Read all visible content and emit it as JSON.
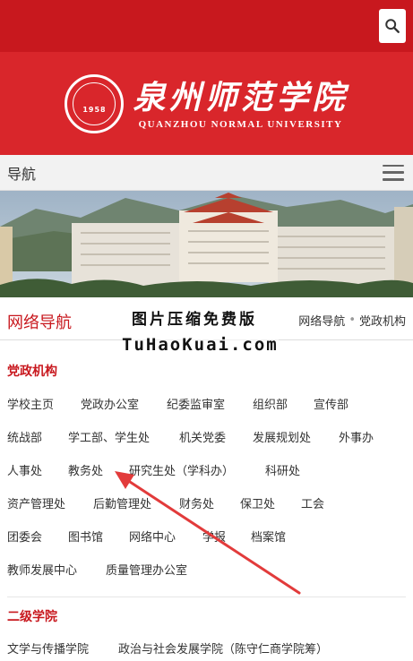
{
  "search": {
    "icon": "search-icon"
  },
  "banner": {
    "logo_cn": "泉州师范学院",
    "logo_en": "QUANZHOU NORMAL UNIVERSITY",
    "seal_year": "1958",
    "brand_color": "#d9262b"
  },
  "nav": {
    "title": "导航",
    "menu_icon": "hamburger-menu-icon"
  },
  "section": {
    "title": "网络导航",
    "breadcrumb": [
      "网络导航",
      "党政机构"
    ]
  },
  "watermark": {
    "line1": "图片压缩免费版",
    "line2": "TuHaoKuai.com"
  },
  "groups": [
    {
      "title": "党政机构",
      "rows": [
        [
          "学校主页",
          "党政办公室",
          "纪委监审室",
          "组织部",
          "宣传部"
        ],
        [
          "统战部",
          "学工部、学生处",
          "机关党委",
          "发展规划处",
          "外事办"
        ],
        [
          "人事处",
          "教务处",
          "研究生处（学科办）",
          "科研处"
        ],
        [
          "资产管理处",
          "后勤管理处",
          "财务处",
          "保卫处",
          "工会"
        ],
        [
          "团委会",
          "图书馆",
          "网络中心",
          "学报",
          "档案馆"
        ],
        [
          "教师发展中心",
          "质量管理办公室"
        ]
      ]
    },
    {
      "title": "二级学院",
      "rows": [
        [
          "文学与传播学院",
          "政治与社会发展学院（陈守仁商学院筹）"
        ]
      ]
    }
  ]
}
